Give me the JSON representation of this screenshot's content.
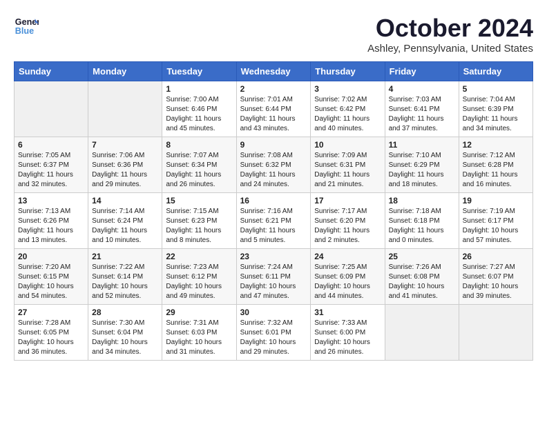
{
  "header": {
    "logo_line1": "General",
    "logo_line2": "Blue",
    "month_title": "October 2024",
    "location": "Ashley, Pennsylvania, United States"
  },
  "weekdays": [
    "Sunday",
    "Monday",
    "Tuesday",
    "Wednesday",
    "Thursday",
    "Friday",
    "Saturday"
  ],
  "weeks": [
    [
      {
        "day": "",
        "info": ""
      },
      {
        "day": "",
        "info": ""
      },
      {
        "day": "1",
        "info": "Sunrise: 7:00 AM\nSunset: 6:46 PM\nDaylight: 11 hours and 45 minutes."
      },
      {
        "day": "2",
        "info": "Sunrise: 7:01 AM\nSunset: 6:44 PM\nDaylight: 11 hours and 43 minutes."
      },
      {
        "day": "3",
        "info": "Sunrise: 7:02 AM\nSunset: 6:42 PM\nDaylight: 11 hours and 40 minutes."
      },
      {
        "day": "4",
        "info": "Sunrise: 7:03 AM\nSunset: 6:41 PM\nDaylight: 11 hours and 37 minutes."
      },
      {
        "day": "5",
        "info": "Sunrise: 7:04 AM\nSunset: 6:39 PM\nDaylight: 11 hours and 34 minutes."
      }
    ],
    [
      {
        "day": "6",
        "info": "Sunrise: 7:05 AM\nSunset: 6:37 PM\nDaylight: 11 hours and 32 minutes."
      },
      {
        "day": "7",
        "info": "Sunrise: 7:06 AM\nSunset: 6:36 PM\nDaylight: 11 hours and 29 minutes."
      },
      {
        "day": "8",
        "info": "Sunrise: 7:07 AM\nSunset: 6:34 PM\nDaylight: 11 hours and 26 minutes."
      },
      {
        "day": "9",
        "info": "Sunrise: 7:08 AM\nSunset: 6:32 PM\nDaylight: 11 hours and 24 minutes."
      },
      {
        "day": "10",
        "info": "Sunrise: 7:09 AM\nSunset: 6:31 PM\nDaylight: 11 hours and 21 minutes."
      },
      {
        "day": "11",
        "info": "Sunrise: 7:10 AM\nSunset: 6:29 PM\nDaylight: 11 hours and 18 minutes."
      },
      {
        "day": "12",
        "info": "Sunrise: 7:12 AM\nSunset: 6:28 PM\nDaylight: 11 hours and 16 minutes."
      }
    ],
    [
      {
        "day": "13",
        "info": "Sunrise: 7:13 AM\nSunset: 6:26 PM\nDaylight: 11 hours and 13 minutes."
      },
      {
        "day": "14",
        "info": "Sunrise: 7:14 AM\nSunset: 6:24 PM\nDaylight: 11 hours and 10 minutes."
      },
      {
        "day": "15",
        "info": "Sunrise: 7:15 AM\nSunset: 6:23 PM\nDaylight: 11 hours and 8 minutes."
      },
      {
        "day": "16",
        "info": "Sunrise: 7:16 AM\nSunset: 6:21 PM\nDaylight: 11 hours and 5 minutes."
      },
      {
        "day": "17",
        "info": "Sunrise: 7:17 AM\nSunset: 6:20 PM\nDaylight: 11 hours and 2 minutes."
      },
      {
        "day": "18",
        "info": "Sunrise: 7:18 AM\nSunset: 6:18 PM\nDaylight: 11 hours and 0 minutes."
      },
      {
        "day": "19",
        "info": "Sunrise: 7:19 AM\nSunset: 6:17 PM\nDaylight: 10 hours and 57 minutes."
      }
    ],
    [
      {
        "day": "20",
        "info": "Sunrise: 7:20 AM\nSunset: 6:15 PM\nDaylight: 10 hours and 54 minutes."
      },
      {
        "day": "21",
        "info": "Sunrise: 7:22 AM\nSunset: 6:14 PM\nDaylight: 10 hours and 52 minutes."
      },
      {
        "day": "22",
        "info": "Sunrise: 7:23 AM\nSunset: 6:12 PM\nDaylight: 10 hours and 49 minutes."
      },
      {
        "day": "23",
        "info": "Sunrise: 7:24 AM\nSunset: 6:11 PM\nDaylight: 10 hours and 47 minutes."
      },
      {
        "day": "24",
        "info": "Sunrise: 7:25 AM\nSunset: 6:09 PM\nDaylight: 10 hours and 44 minutes."
      },
      {
        "day": "25",
        "info": "Sunrise: 7:26 AM\nSunset: 6:08 PM\nDaylight: 10 hours and 41 minutes."
      },
      {
        "day": "26",
        "info": "Sunrise: 7:27 AM\nSunset: 6:07 PM\nDaylight: 10 hours and 39 minutes."
      }
    ],
    [
      {
        "day": "27",
        "info": "Sunrise: 7:28 AM\nSunset: 6:05 PM\nDaylight: 10 hours and 36 minutes."
      },
      {
        "day": "28",
        "info": "Sunrise: 7:30 AM\nSunset: 6:04 PM\nDaylight: 10 hours and 34 minutes."
      },
      {
        "day": "29",
        "info": "Sunrise: 7:31 AM\nSunset: 6:03 PM\nDaylight: 10 hours and 31 minutes."
      },
      {
        "day": "30",
        "info": "Sunrise: 7:32 AM\nSunset: 6:01 PM\nDaylight: 10 hours and 29 minutes."
      },
      {
        "day": "31",
        "info": "Sunrise: 7:33 AM\nSunset: 6:00 PM\nDaylight: 10 hours and 26 minutes."
      },
      {
        "day": "",
        "info": ""
      },
      {
        "day": "",
        "info": ""
      }
    ]
  ]
}
